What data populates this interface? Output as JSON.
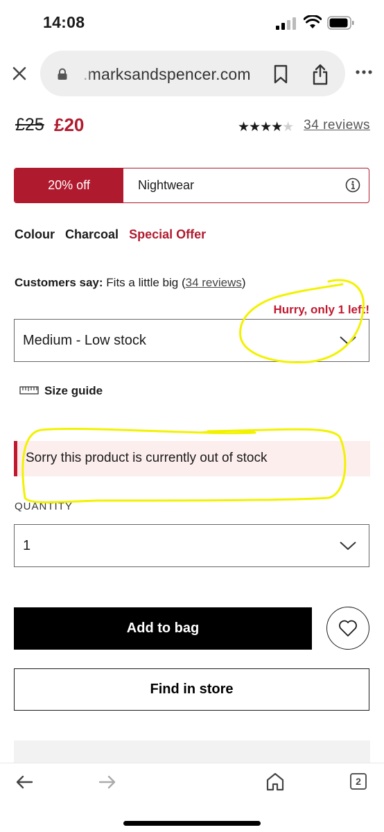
{
  "status_bar": {
    "time": "14:08"
  },
  "browser": {
    "url": ".marksandspencer.com",
    "tab_count": "2"
  },
  "product": {
    "price_old": "£25",
    "price_new": "£20",
    "rating_stars": 4,
    "rating_max": 5,
    "reviews_link": "34 reviews"
  },
  "offer": {
    "tag": "20% off",
    "text": "Nightwear"
  },
  "colour": {
    "label": "Colour",
    "value": "Charcoal",
    "special": "Special Offer"
  },
  "customers_say": {
    "label": "Customers say:",
    "text": "Fits a little big",
    "open_paren": "(",
    "link": "34 reviews",
    "close_paren": ")"
  },
  "stock_warning": "Hurry, only 1 left!",
  "size_select": {
    "value": "Medium - Low stock"
  },
  "size_guide": "Size guide",
  "out_of_stock": "Sorry this product is currently out of stock",
  "quantity": {
    "label": "QUANTITY",
    "value": "1"
  },
  "buttons": {
    "add_to_bag": "Add to bag",
    "find_in_store": "Find in store"
  },
  "colors": {
    "brand_red": "#b01a2e",
    "annotation_yellow": "#f2f200",
    "alert_bg": "#fdeeee"
  },
  "icons": [
    "close-icon",
    "lock-icon",
    "bookmark-icon",
    "share-icon",
    "more-icon",
    "info-icon",
    "chevron-down-icon",
    "ruler-icon",
    "heart-icon",
    "back-icon",
    "forward-icon",
    "home-icon",
    "tabs-icon"
  ]
}
